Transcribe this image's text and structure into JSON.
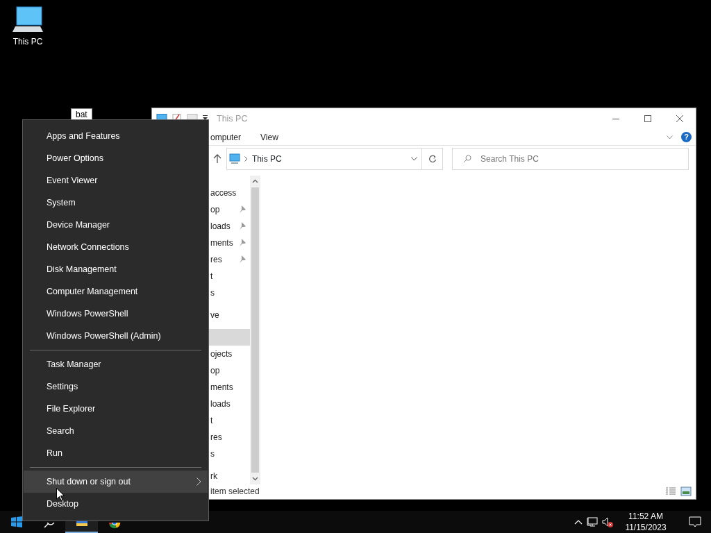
{
  "desktop_icons": [
    {
      "label": "This PC"
    }
  ],
  "tooltip": {
    "text": "bat"
  },
  "explorer": {
    "title": "This PC",
    "ribbon_tabs": [
      {
        "label": "omputer",
        "selected": false
      },
      {
        "label": "View",
        "selected": false
      }
    ],
    "help_glyph": "?",
    "address": {
      "path": "This PC"
    },
    "search": {
      "placeholder": "Search This PC"
    },
    "nav": [
      {
        "label": "access",
        "selected": false,
        "children": [
          {
            "label": "op",
            "pinned": true,
            "selected": false
          },
          {
            "label": "loads",
            "pinned": true,
            "selected": false
          },
          {
            "label": "ments",
            "pinned": true,
            "selected": false
          },
          {
            "label": "res",
            "pinned": true,
            "selected": false
          },
          {
            "label": "t",
            "pinned": false,
            "selected": false
          },
          {
            "label": "s",
            "pinned": false,
            "selected": false
          }
        ]
      },
      {
        "label": "ve",
        "selected": false
      },
      {
        "selected": true,
        "children": [
          {
            "label": "ojects",
            "selected": false
          },
          {
            "label": "op",
            "selected": false
          },
          {
            "label": "ments",
            "selected": false
          },
          {
            "label": "loads",
            "selected": false
          },
          {
            "label": "t",
            "selected": false
          },
          {
            "label": "res",
            "selected": false
          },
          {
            "label": "s",
            "selected": false
          }
        ]
      },
      {
        "label": "rk",
        "selected": false
      }
    ],
    "status": "item selected"
  },
  "context_menu": {
    "groups": [
      [
        {
          "label": "Apps and Features",
          "highlighted": false,
          "submenu": false
        },
        {
          "label": "Power Options",
          "highlighted": false,
          "submenu": false
        },
        {
          "label": "Event Viewer",
          "highlighted": false,
          "submenu": false
        },
        {
          "label": "System",
          "highlighted": false,
          "submenu": false
        },
        {
          "label": "Device Manager",
          "highlighted": false,
          "submenu": false
        },
        {
          "label": "Network Connections",
          "highlighted": false,
          "submenu": false
        },
        {
          "label": "Disk Management",
          "highlighted": false,
          "submenu": false
        },
        {
          "label": "Computer Management",
          "highlighted": false,
          "submenu": false
        },
        {
          "label": "Windows PowerShell",
          "highlighted": false,
          "submenu": false
        },
        {
          "label": "Windows PowerShell (Admin)",
          "highlighted": false,
          "submenu": false
        }
      ],
      [
        {
          "label": "Task Manager",
          "highlighted": false,
          "submenu": false
        },
        {
          "label": "Settings",
          "highlighted": false,
          "submenu": false
        },
        {
          "label": "File Explorer",
          "highlighted": false,
          "submenu": false
        },
        {
          "label": "Search",
          "highlighted": false,
          "submenu": false
        },
        {
          "label": "Run",
          "highlighted": false,
          "submenu": false
        }
      ],
      [
        {
          "label": "Shut down or sign out",
          "highlighted": true,
          "submenu": true
        },
        {
          "label": "Desktop",
          "highlighted": false,
          "submenu": false
        }
      ]
    ]
  },
  "taskbar": {
    "apps": [
      {
        "kind": "search",
        "running": false
      },
      {
        "kind": "explorer",
        "running": true
      },
      {
        "kind": "chrome",
        "running": false
      }
    ],
    "volume_muted": true,
    "clock": {
      "time": "11:52 AM",
      "date": "11/15/2023"
    }
  }
}
